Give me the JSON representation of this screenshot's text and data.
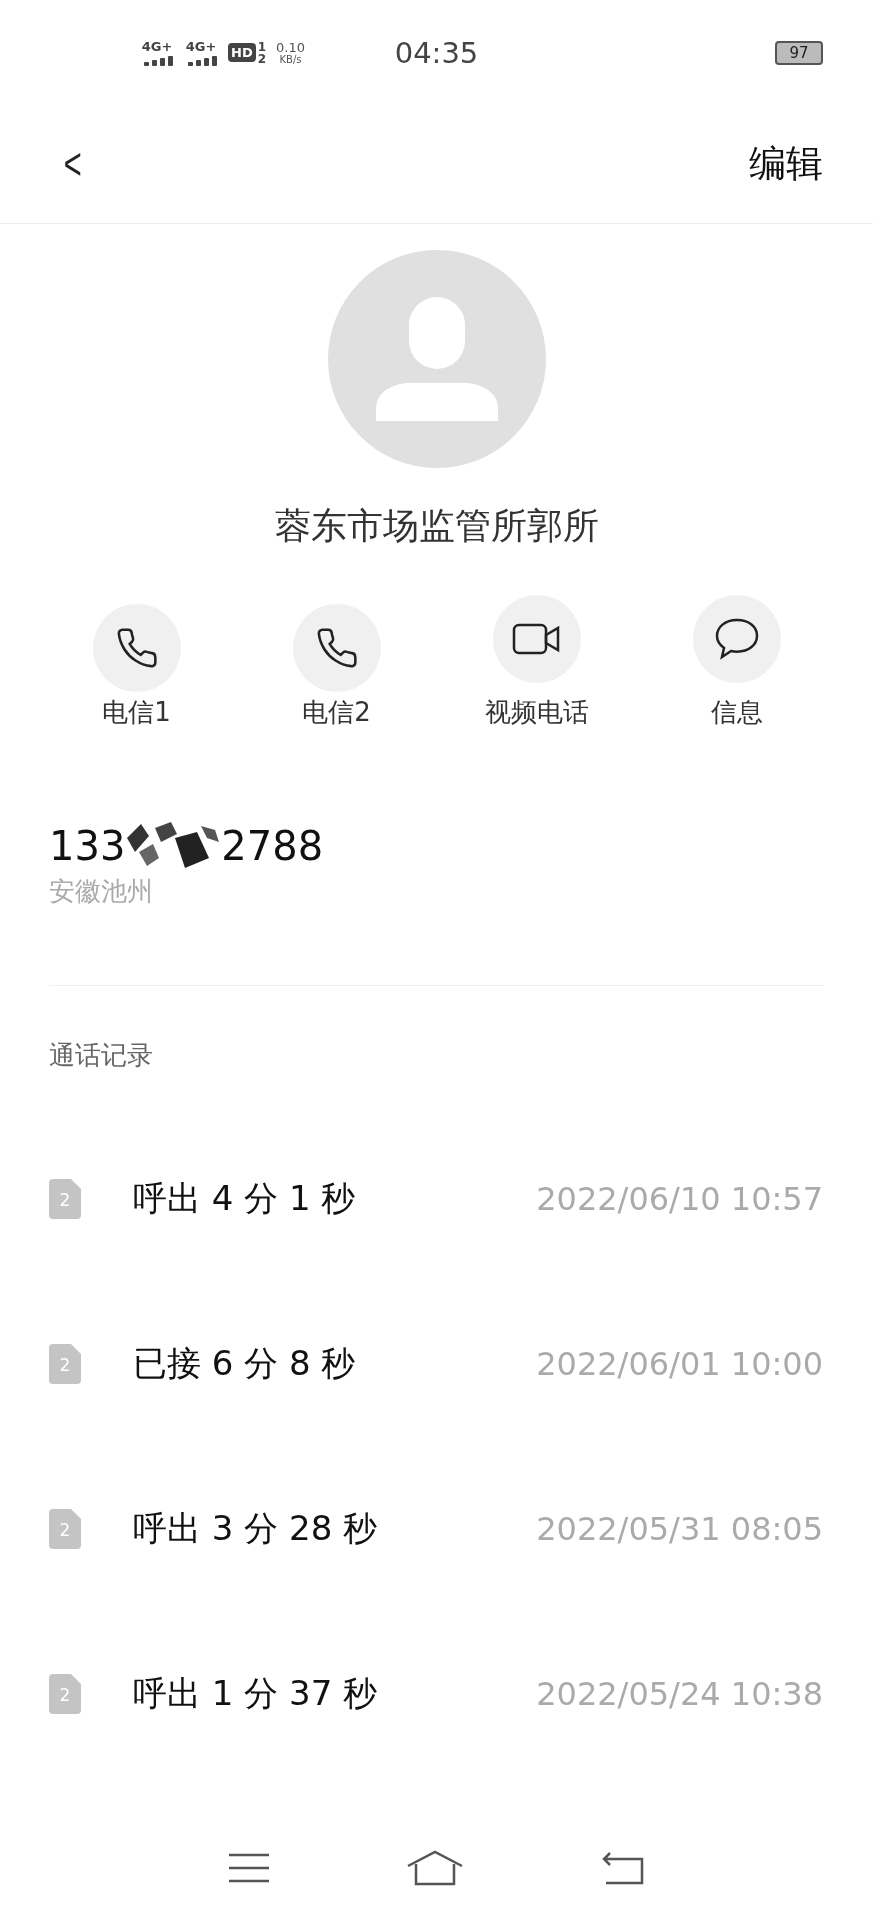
{
  "status_bar": {
    "network_1": "4G+",
    "network_2": "4G+",
    "hd": "HD",
    "sim_1": "1",
    "sim_2": "2",
    "speed": "0.10",
    "speed_unit": "KB/s",
    "time": "04:35",
    "battery": "97"
  },
  "header": {
    "back": "<",
    "edit": "编辑"
  },
  "contact": {
    "name": "蓉东市场监管所郭所"
  },
  "actions": [
    {
      "kind": "phone",
      "label": "电信1"
    },
    {
      "kind": "phone",
      "label": "电信2"
    },
    {
      "kind": "video",
      "label": "视频电话"
    },
    {
      "kind": "message",
      "label": "信息"
    }
  ],
  "number": {
    "start": "133",
    "end": "2788",
    "location": "安徽池州"
  },
  "call_log": {
    "title": "通话记录",
    "rows": [
      {
        "sim": "2",
        "summary": "呼出 4 分 1 秒",
        "time": "2022/06/10 10:57"
      },
      {
        "sim": "2",
        "summary": "已接 6 分 8 秒",
        "time": "2022/06/01 10:00"
      },
      {
        "sim": "2",
        "summary": "呼出 3 分 28 秒",
        "time": "2022/05/31 08:05"
      },
      {
        "sim": "2",
        "summary": "呼出 1 分 37 秒",
        "time": "2022/05/24 10:38"
      }
    ]
  }
}
